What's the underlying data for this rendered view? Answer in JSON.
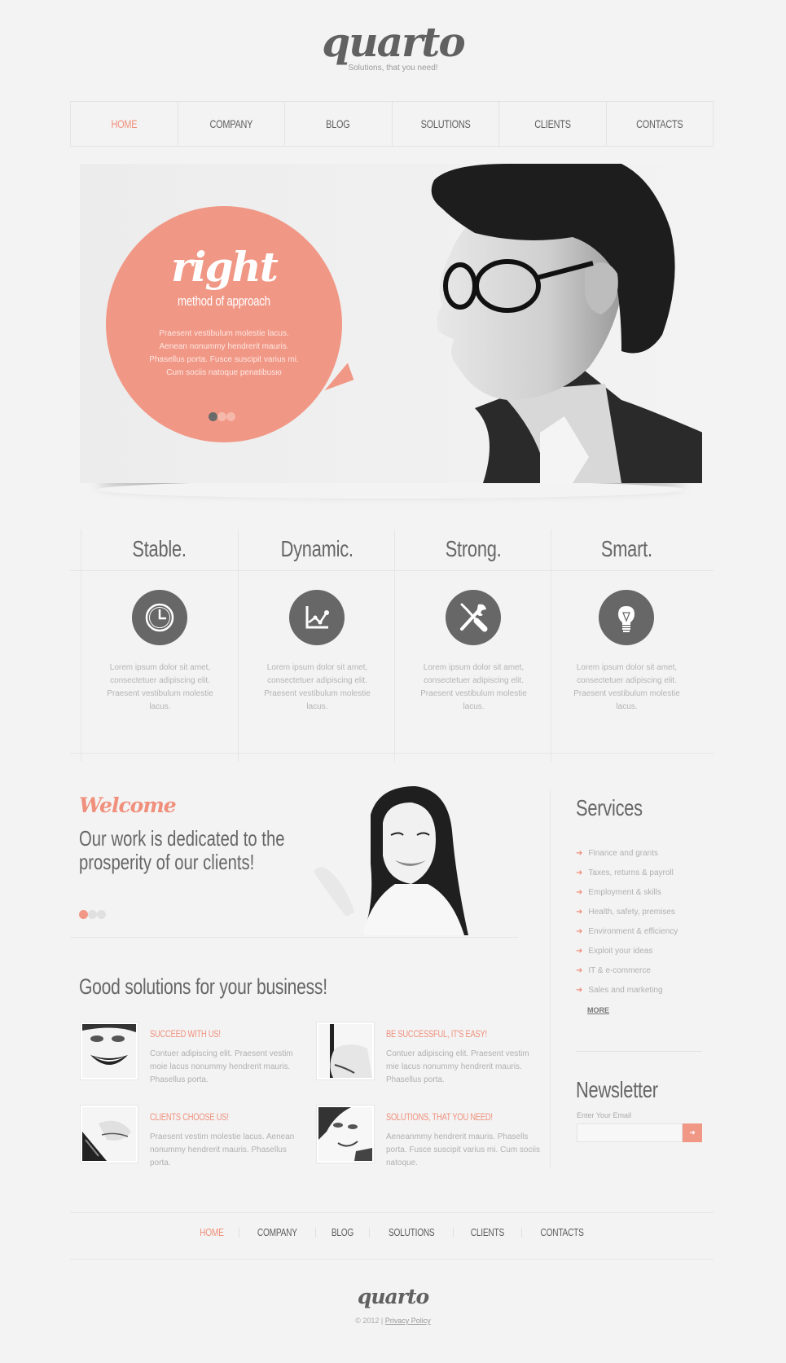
{
  "header": {
    "logo": "quarto",
    "tagline": "Solutions, that you need!"
  },
  "nav": {
    "items": [
      {
        "label": "HOME",
        "active": true
      },
      {
        "label": "COMPANY",
        "active": false
      },
      {
        "label": "BLOG",
        "active": false
      },
      {
        "label": "SOLUTIONS",
        "active": false
      },
      {
        "label": "CLIENTS",
        "active": false
      },
      {
        "label": "CONTACTS",
        "active": false
      }
    ]
  },
  "hero": {
    "title": "right",
    "subtitle": "method of approach",
    "text": [
      "Praesent vestibulum molestie lacus.",
      "Aenean nonummy hendrerit mauris.",
      "Phasellus porta. Fusce suscipit varius mi.",
      "Cum sociis natoque penatibusю"
    ],
    "slides": 3,
    "active_slide": 1
  },
  "features": [
    {
      "title": "Stable.",
      "icon": "clock-icon",
      "text": "Lorem ipsum dolor sit amet, consectetuer adipiscing elit. Praesent vestibulum molestie lacus."
    },
    {
      "title": "Dynamic.",
      "icon": "chart-icon",
      "text": "Lorem ipsum dolor sit amet, consectetuer adipiscing elit. Praesent vestibulum molestie lacus."
    },
    {
      "title": "Strong.",
      "icon": "tools-icon",
      "text": "Lorem ipsum dolor sit amet, consectetuer adipiscing elit. Praesent vestibulum molestie lacus."
    },
    {
      "title": "Smart.",
      "icon": "lightbulb-icon",
      "text": "Lorem ipsum dolor sit amet, consectetuer adipiscing elit. Praesent vestibulum molestie lacus."
    }
  ],
  "welcome": {
    "title": "Welcome",
    "text": "Our work is dedicated to the prosperity of our clients!",
    "slides": 3,
    "active_slide": 1
  },
  "services": {
    "title": "Services",
    "items": [
      "Finance and grants",
      "Taxes, returns & payroll",
      "Employment & skills",
      "Health, safety, premises",
      "Environment & efficiency",
      "Exploit your ideas",
      "IT & e-commerce",
      "Sales and marketing"
    ],
    "more": "MORE"
  },
  "newsletter": {
    "title": "Newsletter",
    "label": "Enter Your Email",
    "value": "",
    "button": "➜"
  },
  "solutions": {
    "title": "Good solutions for your business!",
    "items": [
      {
        "title": "SUCCEED WITH US!",
        "text": "Contuer adipiscing elit. Praesent vestim moie lacus nonummy hendrerit mauris. Phasellus porta."
      },
      {
        "title": "BE SUCCESSFUL, IT'S EASY!",
        "text": "Contuer adipiscing elit. Praesent vestim mie lacus nonummy hendrerit mauris. Phasellus porta."
      },
      {
        "title": "CLIENTS CHOOSE US!",
        "text": "Praesent vestim molestie lacus. Aenean nonummy hendrerit mauris. Phasellus porta."
      },
      {
        "title": "SOLUTIONS, THAT YOU NEED!",
        "text": "Aeneanmmy hendrerit mauris. Phasells porta. Fusce suscipit varius mi. Cum sociis natoque."
      }
    ]
  },
  "footer": {
    "nav": [
      "HOME",
      "COMPANY",
      "BLOG",
      "SOLUTIONS",
      "CLIENTS",
      "CONTACTS"
    ],
    "logo": "quarto",
    "copyright": "© 2012",
    "separator": "|",
    "privacy": "Privacy Policy"
  },
  "colors": {
    "accent": "#f0907c",
    "bubble": "#f19785",
    "text": "#666666",
    "muted": "#b0b0b0",
    "icon_bg": "#676767"
  }
}
